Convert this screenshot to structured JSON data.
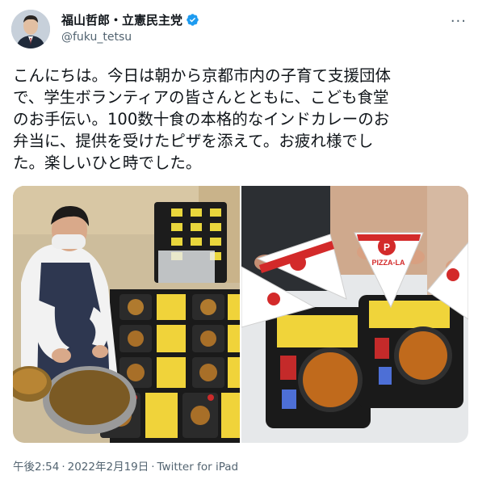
{
  "author": {
    "display_name": "福山哲郎・立憲民主党",
    "handle": "@fuku_tetsu"
  },
  "tweet": {
    "lines": [
      "こんにちは。今日は朝から京都市内の子育て支援団体",
      "で、学生ボランティアの皆さんとともに、こども食堂",
      "のお手伝い。100数十食の本格的なインドカレーのお",
      "弁当に、提供を受けたピザを添えて。お疲れ様でし",
      "た。楽しいひと時でした。"
    ]
  },
  "photo_right": {
    "box_brand": "PIZZA-LA",
    "box_logo_letter": "P"
  },
  "meta": {
    "time": "午後2:54",
    "separator": "·",
    "date": "2022年2月19日",
    "source": "Twitter for iPad"
  },
  "icons": [
    "verified-badge-icon",
    "more-options-icon"
  ],
  "colors": {
    "text": "#0f1419",
    "secondary": "#536471",
    "verified": "#1d9bf0"
  }
}
